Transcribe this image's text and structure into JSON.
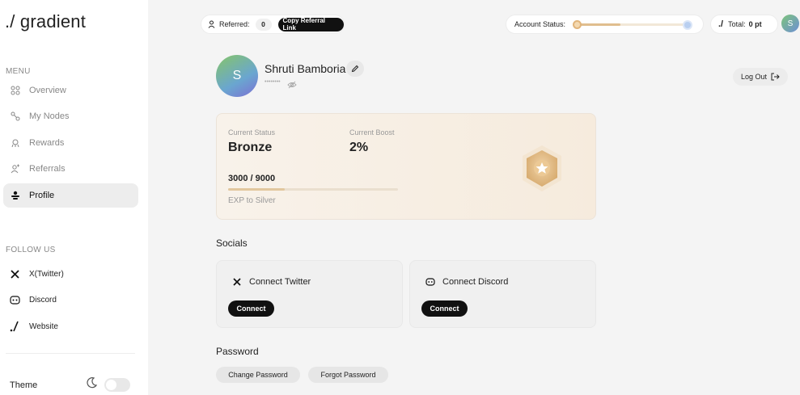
{
  "sidebar": {
    "brand": "./ gradient",
    "menu_label": "MENU",
    "items": [
      {
        "label": "Overview",
        "icon": "grid-icon"
      },
      {
        "label": "My Nodes",
        "icon": "nodes-icon"
      },
      {
        "label": "Rewards",
        "icon": "rewards-icon"
      },
      {
        "label": "Referrals",
        "icon": "referrals-icon"
      },
      {
        "label": "Profile",
        "icon": "profile-icon"
      }
    ],
    "follow_label": "FOLLOW US",
    "socials": [
      {
        "label": "X(Twitter)",
        "icon": "x-icon"
      },
      {
        "label": "Discord",
        "icon": "discord-icon"
      },
      {
        "label": "Website",
        "icon": "gradient-logo-icon"
      }
    ],
    "theme_label": "Theme"
  },
  "topbar": {
    "referred_label": "Referred:",
    "referred_count": "0",
    "copy_link_label": "Copy Referral Link",
    "account_status_label": "Account Status:",
    "total_logo": "./",
    "total_label": "Total:",
    "total_value": "0 pt",
    "avatar_initial": "S"
  },
  "profile": {
    "avatar_initial": "S",
    "name": "Shruti Bamboria",
    "masked_email": "••••••••",
    "logout_label": "Log Out"
  },
  "status_card": {
    "current_status_label": "Current Status",
    "current_status_value": "Bronze",
    "current_boost_label": "Current Boost",
    "current_boost_value": "2%",
    "exp_progress": "3000 / 9000",
    "exp_fraction": 0.333,
    "exp_next_label": "EXP to Silver"
  },
  "socials_section": {
    "title": "Socials",
    "twitter_title": "Connect Twitter",
    "twitter_button": "Connect",
    "discord_title": "Connect Discord",
    "discord_button": "Connect"
  },
  "password_section": {
    "title": "Password",
    "change_label": "Change Password",
    "forgot_label": "Forgot Password"
  },
  "colors": {
    "accent_dark": "#111111",
    "bronze": "#e2c79e",
    "panel_bg": "#f4f4f4"
  }
}
